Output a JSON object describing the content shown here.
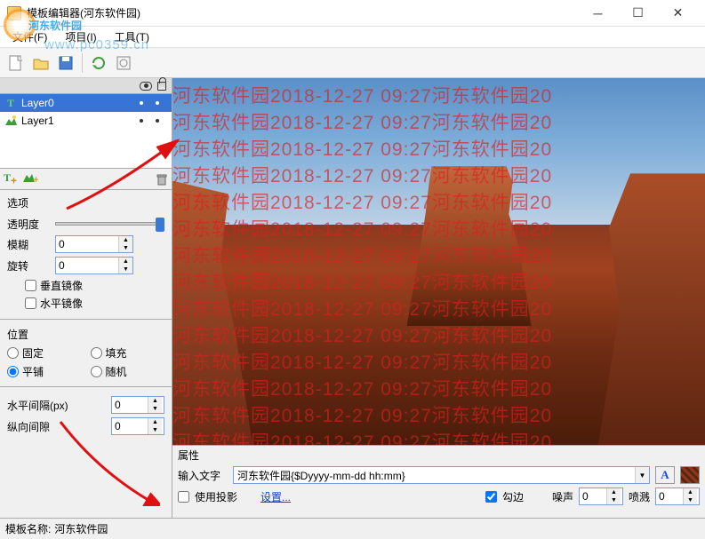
{
  "window": {
    "title": "模板编辑器(河东软件园)"
  },
  "menu": {
    "file": "文件(F)",
    "project": "项目(I)",
    "tools": "工具(T)"
  },
  "layers": {
    "items": [
      {
        "name": "Layer0",
        "selected": true,
        "type": "text"
      },
      {
        "name": "Layer1",
        "selected": false,
        "type": "image"
      }
    ]
  },
  "options": {
    "title": "选项",
    "opacity_label": "透明度",
    "blur_label": "模糊",
    "blur_value": "0",
    "rotate_label": "旋转",
    "rotate_value": "0",
    "vmirror": "垂直镜像",
    "hmirror": "水平镜像"
  },
  "position": {
    "title": "位置",
    "fixed": "固定",
    "fill": "填充",
    "tile": "平铺",
    "random": "随机",
    "hspace_label": "水平间隔(px)",
    "hspace_value": "0",
    "vspace_label": "纵向间隙",
    "vspace_value": "0"
  },
  "properties": {
    "title": "属性",
    "input_label": "输入文字",
    "input_value": "河东软件园{$Dyyyy-mm-dd hh:mm}",
    "shadow": "使用投影",
    "settings_link": "设置...",
    "stroke": "勾边",
    "noise_label": "噪声",
    "noise_value": "0",
    "spray_label": "喷溅",
    "spray_value": "0"
  },
  "status": {
    "label": "模板名称:",
    "value": "河东软件园"
  },
  "watermark": {
    "site_name": "河东软件园",
    "url": "www.pc0359.cn",
    "overlay_text": "河东软件园2018-12-27 09:27河东软件园20"
  }
}
